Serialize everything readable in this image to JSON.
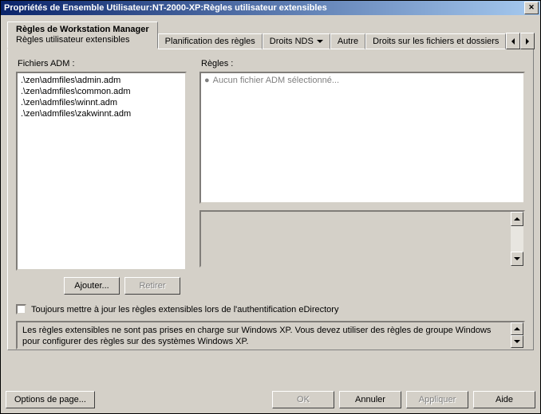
{
  "window": {
    "title": "Propriétés de Ensemble Utilisateur:NT-2000-XP:Règles utilisateur extensibles"
  },
  "tabs": {
    "active": {
      "line1": "Règles de Workstation Manager",
      "line2": "Règles utilisateur extensibles"
    },
    "others": [
      "Planification des règles",
      "Droits NDS",
      "Autre",
      "Droits sur les fichiers et dossiers"
    ]
  },
  "labels": {
    "adm_files": "Fichiers ADM :",
    "rules": "Règles :"
  },
  "adm_files": [
    ".\\zen\\admfiles\\admin.adm",
    ".\\zen\\admfiles\\common.adm",
    ".\\zen\\admfiles\\winnt.adm",
    ".\\zen\\admfiles\\zakwinnt.adm"
  ],
  "rules_list": {
    "placeholder": "Aucun fichier ADM sélectionné..."
  },
  "buttons": {
    "add": "Ajouter...",
    "remove": "Retirer",
    "page_options": "Options de page...",
    "ok": "OK",
    "cancel": "Annuler",
    "apply": "Appliquer",
    "help": "Aide"
  },
  "checkbox": {
    "label": "Toujours mettre à jour les règles extensibles lors de l'authentification eDirectory"
  },
  "notice": "Les règles extensibles ne sont pas prises en charge sur Windows XP. Vous devez utiliser des règles de groupe Windows pour configurer des règles sur des systèmes Windows XP."
}
